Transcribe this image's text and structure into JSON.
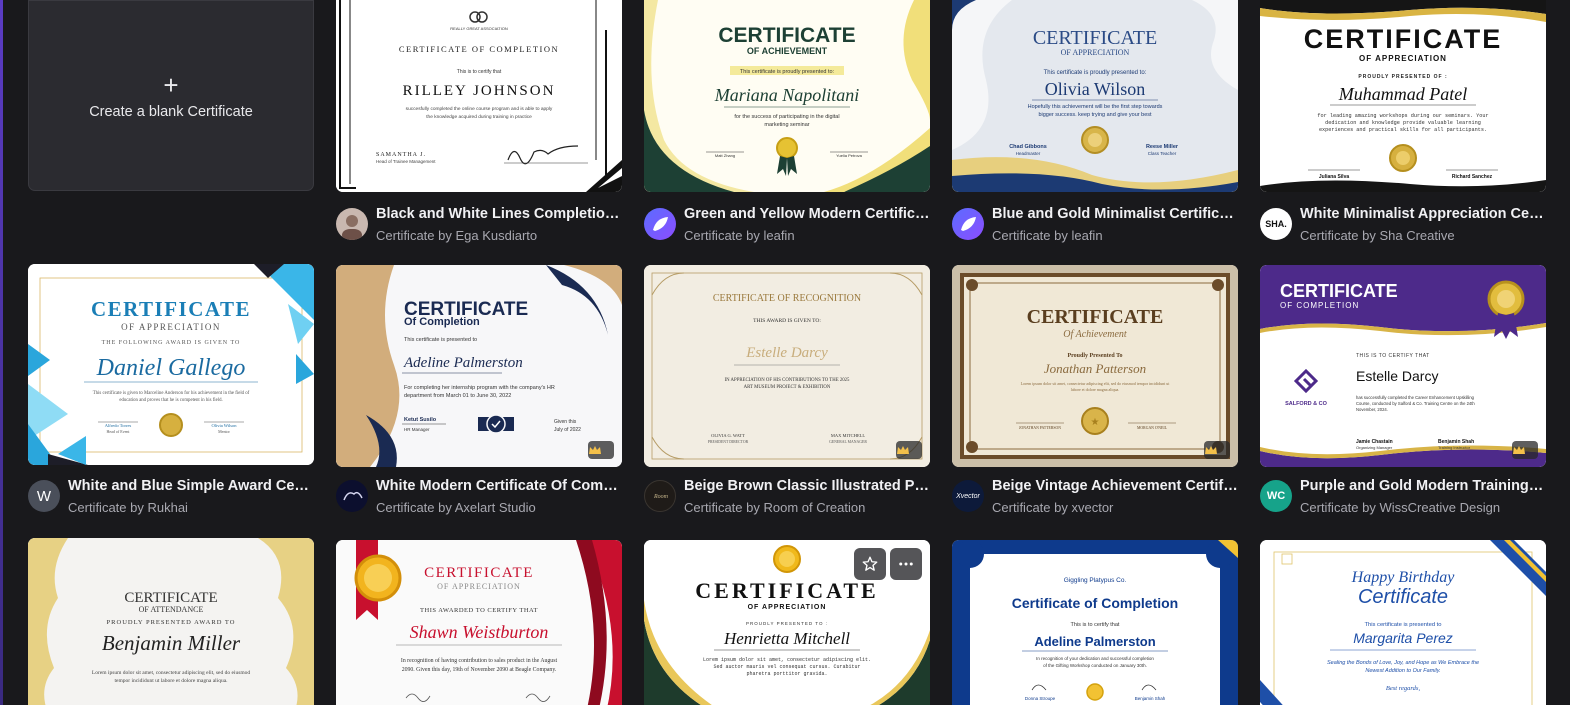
{
  "blank": {
    "plus": "+",
    "label": "Create a blank Certificate"
  },
  "templates": [
    {
      "title": "Black and White Lines Completion Certificate",
      "by": "Certificate by Ega Kusdiarto",
      "avatar": "",
      "thumb": {
        "head": "CERTIFICATE OF COMPLETION",
        "sub": "This is to certify that",
        "name": "RILLEY JOHNSON",
        "body": "succesfully completed the online course program and is able to apply the knowledge acquired during training in practice",
        "sign1": "SAMANTHA J.",
        "sign1role": "Head of Trainee Management",
        "org": "REALLY GREAT ASSOCIATION",
        "sig": "Signature"
      }
    },
    {
      "title": "Green and Yellow Modern Certificate of Achievement",
      "by": "Certificate by leafin",
      "avatar": "",
      "thumb": {
        "head": "CERTIFICATE",
        "sub2": "OF ACHIEVEMENT",
        "sub": "This certificate is proudly presented to:",
        "name": "Mariana Napolitani",
        "body": "for the success of participating in the digital marketing seminar",
        "sign1": "Matt Zhang",
        "sign1role": "Head Event",
        "sign2": "Yuelia Petrova",
        "sign2role": "Pakar"
      }
    },
    {
      "title": "Blue and Gold Minimalist Certificate of Appreciation",
      "by": "Certificate by leafin",
      "avatar": "",
      "thumb": {
        "head": "CERTIFICATE",
        "sub2": "OF APPRECIATION",
        "sub": "This certificate is proudly presented to:",
        "name": "Olivia Wilson",
        "body": "Hopefully this achievement will be the first step towards bigger success. keep trying and give your best",
        "sign1": "Chad Gibbons",
        "sign1role": "Headmaster",
        "sign2": "Reese Miller",
        "sign2role": "Class Teacher"
      }
    },
    {
      "title": "White Minimalist Appreciation Certificate",
      "by": "Certificate by Sha Creative",
      "avatar": "SHA.",
      "thumb": {
        "head": "CERTIFICATE",
        "sub2": "OF APPRECIATION",
        "sub": "PROUDLY PRESENTED OF :",
        "name": "Muhammad Patel",
        "body": "for leading amazing workshops during our seminars. Your dedication and knowledge provide valuable learning experiences and practical skills for all participants.",
        "sign1": "Juliana Silva",
        "sign2": "Richard Sanchez"
      }
    },
    {
      "title": "White and Blue Simple Award Certificate",
      "by": "Certificate by Rukhai",
      "avatar": "W",
      "thumb": {
        "head": "CERTIFICATE",
        "sub2": "OF APPRECIATION",
        "sub": "THE FOLLOWING AWARD IS GIVEN TO",
        "name": "Daniel Gallego",
        "body": "This certificate is given to Marceline Anderson for his achievement in the field of education and proves that he is competent in his field.",
        "sign1": "Alfredo Torres",
        "sign1role": "Head of Event",
        "sign2": "Olivia Wilson",
        "sign2role": "Mentor"
      }
    },
    {
      "title": "White Modern Certificate Of Completion",
      "by": "Certificate by Axelart Studio",
      "avatar": "",
      "thumb": {
        "head": "CERTIFICATE",
        "sub2": "Of Completion",
        "sub": "This certificate is presented to",
        "name": "Adeline Palmerston",
        "body": "For completing her internship program with the company's HR department from March 01 to June 30, 2022",
        "sign1": "Ketut Susilo",
        "sign1role": "HR Manager",
        "sign2": "Given this",
        "sign2role": "July of 2022"
      }
    },
    {
      "title": "Beige Brown Classic Illustrated Presentation Certificate",
      "by": "Certificate by Room of Creation",
      "avatar": "",
      "thumb": {
        "head": "CERTIFICATE OF RECOGNITION",
        "sub": "THIS AWARD IS GIVEN TO:",
        "name": "Estelle Darcy",
        "body": "IN APPRECIATION OF HIS CONTRIBUTIONS TO THE 2025 ART MUSEUM PROJECT & EXHIBITION",
        "sign1": "OLIVIA G. WATT",
        "sign1role": "PRESIDENT DIRECTOR",
        "sign2": "MAX MITCHELL",
        "sign2role": "GENERAL MANAGER"
      }
    },
    {
      "title": "Beige Vintage Achievement Certificate",
      "by": "Certificate by xvector",
      "avatar": "Xvector",
      "thumb": {
        "head": "CERTIFICATE",
        "sub2": "Of Achievement",
        "sub": "Proudly Presented To",
        "name": "Jonathan Patterson",
        "body": "Lorem ipsum dolor sit amet, consectetur adipiscing elit, sed do eiusmod tempor incididunt ut labore et dolore magna aliqua.",
        "sign1": "JONATHAN PATTERSON",
        "sign2": "MORGAN O'NEIL"
      }
    },
    {
      "title": "Purple and Gold Modern Training Certificate",
      "by": "Certificate by WissCreative Design",
      "avatar": "WC",
      "thumb": {
        "head": "CERTIFICATE",
        "sub2": "OF COMPLETION",
        "sub": "THIS IS TO CERTIFY THAT",
        "name": "Estelle Darcy",
        "body": "has successfully completed the Career Enhancement Upskilling Course, conducted by Salford & Co. Training Centre on the 24th November, 2024.",
        "sign1": "Jamie Chastain",
        "sign1role": "Organizing Manager",
        "sign2": "Benjamin Shah",
        "sign2role": "Training Instructor",
        "org": "SALFORD & CO"
      }
    },
    {
      "title": "",
      "by": "",
      "avatar": "",
      "thumb": {
        "head": "CERTIFICATE",
        "sub2": "OF ATTENDANCE",
        "sub": "PROUDLY PRESENTED AWARD TO",
        "name": "Benjamin Miller",
        "body": "Lorem ipsum dolor sit amet, consectetur adipiscing elit, sed do eiusmod tempor incididunt ut labore et dolore magna aliqua."
      }
    },
    {
      "title": "",
      "by": "",
      "avatar": "",
      "thumb": {
        "head": "CERTIFICATE",
        "sub2": "OF APPRECIATION",
        "sub": "THIS AWARDED TO CERTIFY THAT",
        "name": "Shawn Weistburton",
        "body": "In recognition of having contribution to sales product in the August 2090. Given this day, 19th of November 2090 at Beagle Company."
      }
    },
    {
      "title": "",
      "by": "",
      "avatar": "",
      "thumb": {
        "head": "CERTIFICATE",
        "sub2": "OF APPRECIATION",
        "sub": "PROUDLY PRESENTED TO :",
        "name": "Henrietta Mitchell",
        "body": "Lorem ipsum dolor sit amet, consectetur adipiscing elit. Sed auctor mauris vel consequat cursus. Curabitur pharetra porttitor gravida."
      }
    },
    {
      "title": "",
      "by": "",
      "avatar": "",
      "thumb": {
        "org": "Giggling Platypus Co.",
        "head": "Certificate of Completion",
        "sub": "This is to certify that",
        "name": "Adeline Palmerston",
        "body": "In recognition of your dedication and successful completion of the Gifting Workshop conducted on January 30th.",
        "sign1": "Donna Stroupe",
        "sign2": "Benjamin Shah"
      }
    },
    {
      "title": "",
      "by": "",
      "avatar": "",
      "thumb": {
        "head": "Happy Birthday",
        "sub2": "Certificate",
        "sub": "This certificate is presented to",
        "name": "Margarita Perez",
        "body": "Sealing the Bonds of Love, Joy, and Hope as We Embrace the Newest Addition to Our Family.",
        "sign1": "Best regards,"
      }
    }
  ],
  "actions": {
    "star_label": "Star",
    "more_label": "More options"
  }
}
